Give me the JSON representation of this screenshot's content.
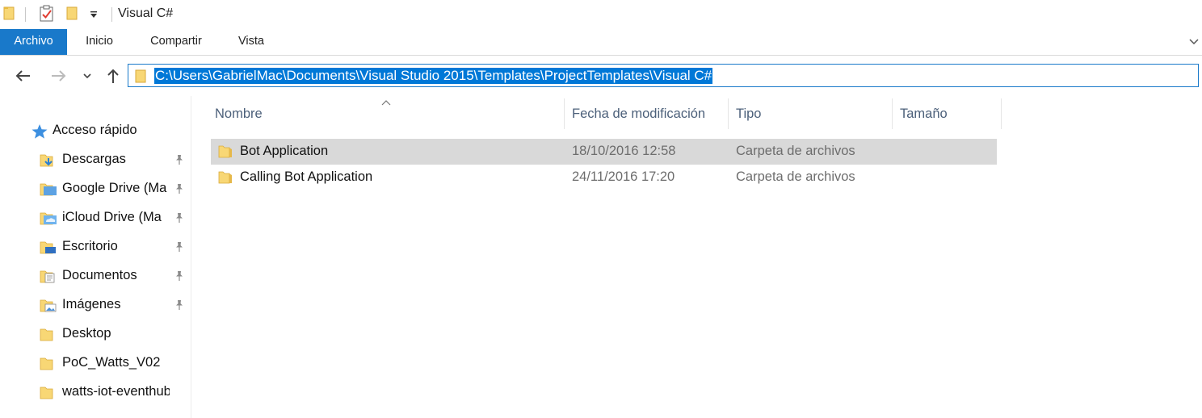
{
  "window": {
    "title": "Visual C#"
  },
  "ribbon": {
    "tabs": [
      {
        "label": "Archivo"
      },
      {
        "label": "Inicio"
      },
      {
        "label": "Compartir"
      },
      {
        "label": "Vista"
      }
    ]
  },
  "navbar": {
    "address": "C:\\Users\\GabrielMac\\Documents\\Visual Studio 2015\\Templates\\ProjectTemplates\\Visual C#"
  },
  "sidebar": {
    "quick_access_label": "Acceso rápido",
    "items": [
      {
        "label": "Descargas",
        "icon": "downloads-folder-icon",
        "pinned": true
      },
      {
        "label": "Google Drive (Ma",
        "icon": "google-drive-folder-icon",
        "pinned": true
      },
      {
        "label": "iCloud Drive (Ma",
        "icon": "icloud-drive-folder-icon",
        "pinned": true
      },
      {
        "label": "Escritorio",
        "icon": "desktop-folder-icon",
        "pinned": true
      },
      {
        "label": "Documentos",
        "icon": "documents-folder-icon",
        "pinned": true
      },
      {
        "label": "Imágenes",
        "icon": "pictures-folder-icon",
        "pinned": true
      },
      {
        "label": "Desktop",
        "icon": "folder-icon",
        "pinned": false
      },
      {
        "label": "PoC_Watts_V02",
        "icon": "folder-icon",
        "pinned": false
      },
      {
        "label": "watts-iot-eventhub-",
        "icon": "folder-icon",
        "pinned": false
      }
    ]
  },
  "filelist": {
    "columns": {
      "name": "Nombre",
      "modified": "Fecha de modificación",
      "type": "Tipo",
      "size": "Tamaño"
    },
    "rows": [
      {
        "name": "Bot Application",
        "modified": "18/10/2016 12:58",
        "type": "Carpeta de archivos",
        "selected": true
      },
      {
        "name": "Calling Bot Application",
        "modified": "24/11/2016 17:20",
        "type": "Carpeta de archivos",
        "selected": false
      }
    ]
  },
  "colors": {
    "accent": "#1979ca",
    "selection_highlight": "#0078d7",
    "selected_row": "#d9d9d9",
    "folder_yellow": "#f8d775"
  }
}
